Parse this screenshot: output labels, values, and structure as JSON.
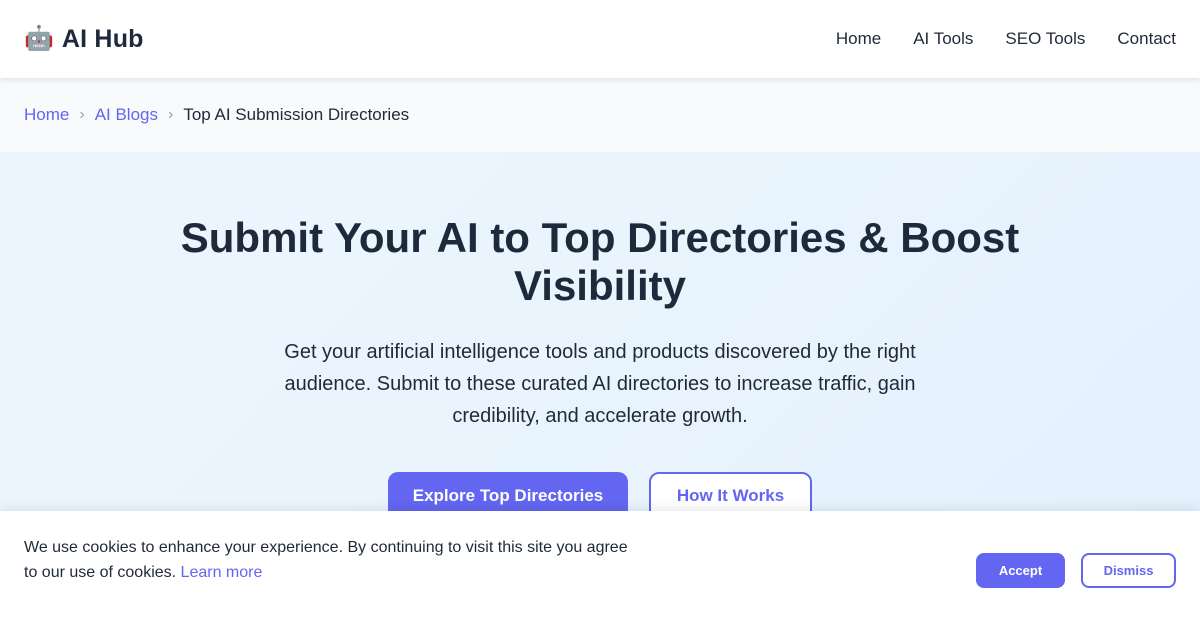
{
  "brand": {
    "icon": "robot-icon",
    "icon_glyph": "🤖",
    "name": "AI Hub"
  },
  "nav": {
    "items": [
      {
        "label": "Home"
      },
      {
        "label": "AI Tools"
      },
      {
        "label": "SEO Tools"
      },
      {
        "label": "Contact"
      }
    ]
  },
  "breadcrumb": {
    "items": [
      {
        "label": "Home"
      },
      {
        "label": "AI Blogs"
      }
    ],
    "separator": "›",
    "current": "Top AI Submission Directories"
  },
  "hero": {
    "title": "Submit Your AI to Top Directories & Boost Visibility",
    "subtitle": "Get your artificial intelligence tools and products discovered by the right audience. Submit to these curated AI directories to increase traffic, gain credibility, and accelerate growth.",
    "primary_button": "Explore Top Directories",
    "secondary_button": "How It Works"
  },
  "cookie": {
    "message": "We use cookies to enhance your experience. By continuing to visit this site you agree to our use of cookies.",
    "link": "Learn more",
    "accept": "Accept",
    "dismiss": "Dismiss"
  },
  "colors": {
    "accent": "#6366f1",
    "heading": "#1e293b",
    "hero_bg": "#e9f4fd",
    "breadcrumb_bg": "#f8fafc"
  }
}
